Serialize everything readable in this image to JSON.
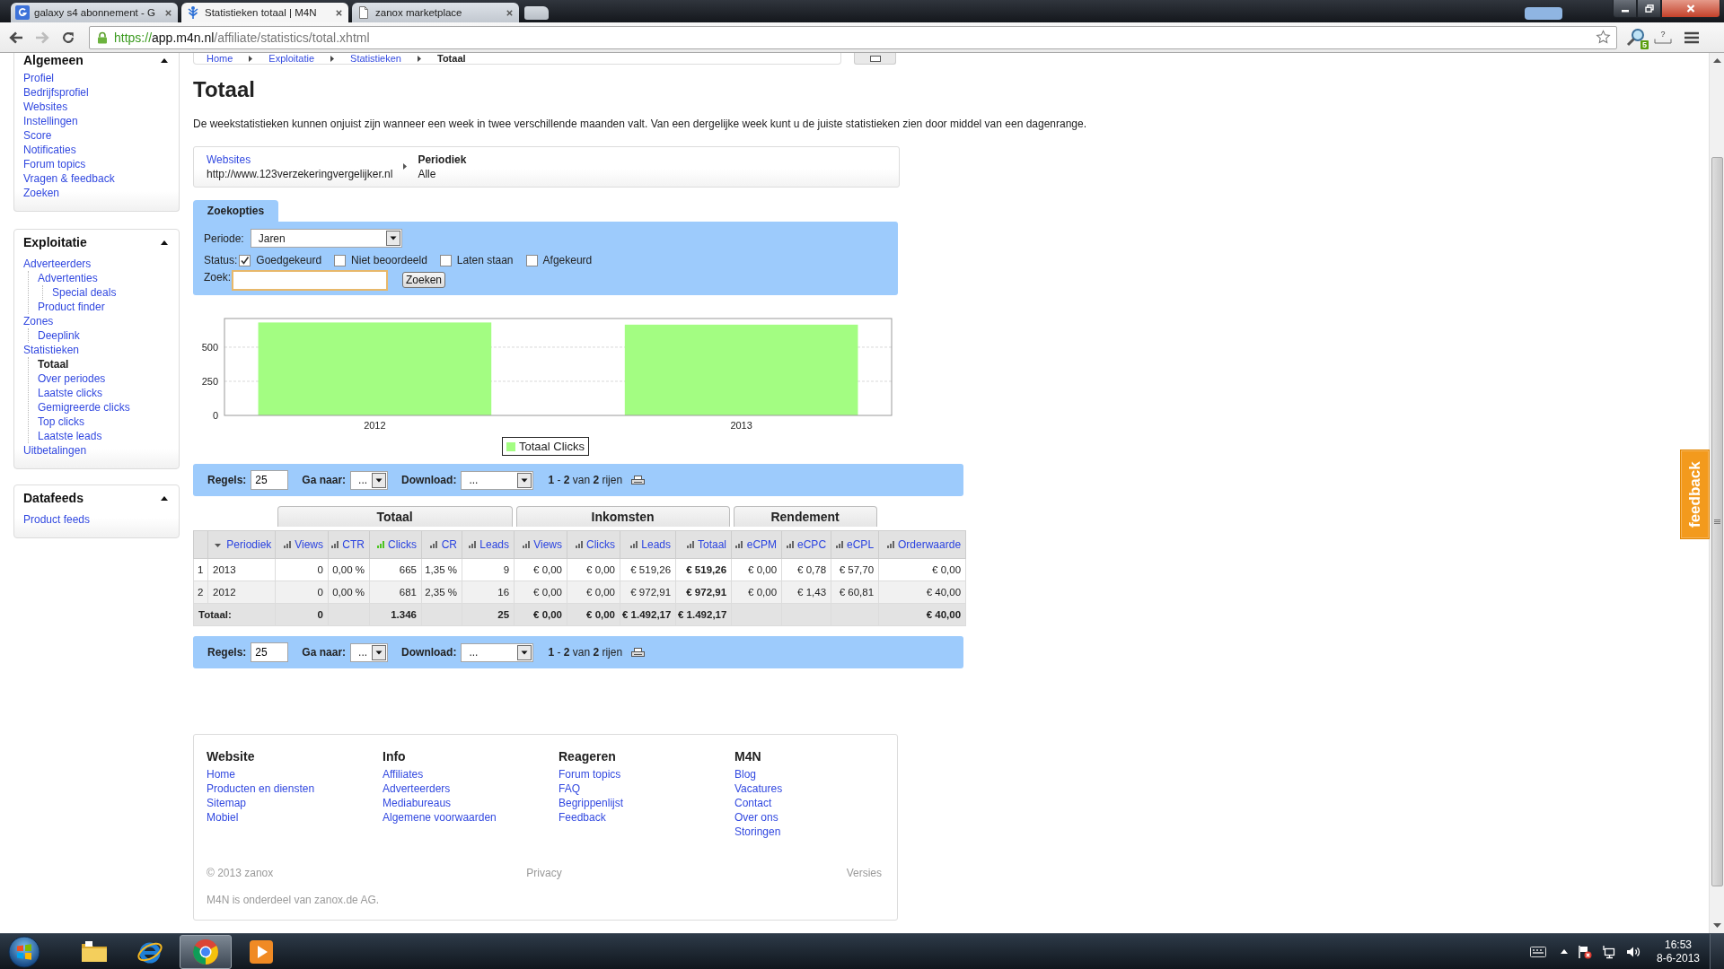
{
  "browser": {
    "tabs": [
      {
        "title": "galaxy s4 abonnement - G",
        "selected": false
      },
      {
        "title": "Statistieken totaal | M4N",
        "selected": true
      },
      {
        "title": "zanox marketplace",
        "selected": false
      }
    ],
    "back": {
      "disabled": false
    },
    "forward": {
      "disabled": true
    },
    "url": {
      "scheme": "https://",
      "host": "app.m4n.nl",
      "path": "/affiliate/statistics/total.xhtml"
    },
    "extension_badge": "5",
    "help_glyph": "?"
  },
  "breadcrumb": [
    {
      "label": "Home",
      "current": false
    },
    {
      "label": "Exploitatie",
      "current": false
    },
    {
      "label": "Statistieken",
      "current": false
    },
    {
      "label": "Totaal",
      "current": true
    }
  ],
  "sidebar": {
    "sections": [
      {
        "title": "Algemeen",
        "expanded": true,
        "items": [
          {
            "label": "Profiel",
            "selected": false
          },
          {
            "label": "Bedrijfsprofiel",
            "selected": false
          },
          {
            "label": "Websites",
            "selected": false
          },
          {
            "label": "Instellingen",
            "selected": false
          },
          {
            "label": "Score",
            "selected": false
          },
          {
            "label": "Notificaties",
            "selected": false
          },
          {
            "label": "Forum topics",
            "selected": false
          },
          {
            "label": "Vragen & feedback",
            "selected": false
          },
          {
            "label": "Zoeken",
            "selected": false
          }
        ]
      },
      {
        "title": "Exploitatie",
        "expanded": true,
        "items": [
          {
            "label": "Adverteerders",
            "selected": false,
            "children": [
              {
                "label": "Advertenties",
                "selected": false,
                "children": [
                  {
                    "label": "Special deals",
                    "selected": false
                  }
                ]
              },
              {
                "label": "Product finder",
                "selected": false
              }
            ]
          },
          {
            "label": "Zones",
            "selected": false,
            "children": [
              {
                "label": "Deeplink",
                "selected": false
              }
            ]
          },
          {
            "label": "Statistieken",
            "selected": false,
            "children": [
              {
                "label": "Totaal",
                "selected": true
              },
              {
                "label": "Over periodes",
                "selected": false
              },
              {
                "label": "Laatste clicks",
                "selected": false
              },
              {
                "label": "Gemigreerde clicks",
                "selected": false
              },
              {
                "label": "Top clicks",
                "selected": false
              },
              {
                "label": "Laatste leads",
                "selected": false
              }
            ]
          },
          {
            "label": "Uitbetalingen",
            "selected": false
          }
        ]
      },
      {
        "title": "Datafeeds",
        "expanded": true,
        "items": [
          {
            "label": "Product feeds",
            "selected": false
          }
        ]
      }
    ]
  },
  "page": {
    "title": "Totaal",
    "notice": "De weekstatistieken kunnen onjuist zijn wanneer een week in twee verschillende maanden valt. Van een dergelijke week kunt u de juiste statistieken zien door middel van een dagenrange."
  },
  "selection_steps": [
    {
      "label": "Websites",
      "value": "http://www.123verzekeringvergelijker.nl",
      "current": false
    },
    {
      "label": "Periodiek",
      "value": "Alle",
      "current": true
    }
  ],
  "search_options": {
    "tab": "Zoekopties",
    "period_label": "Periode:",
    "period_value": "Jaren",
    "status_label": "Status:",
    "statuses": [
      {
        "label": "Goedgekeurd",
        "checked": true
      },
      {
        "label": "Niet beoordeeld",
        "checked": false
      },
      {
        "label": "Laten staan",
        "checked": false
      },
      {
        "label": "Afgekeurd",
        "checked": false
      }
    ],
    "search_label": "Zoek:",
    "search_field": {
      "focused": true
    },
    "search_button": "Zoeken"
  },
  "chart": {
    "chart_data": {
      "type": "bar",
      "categories": [
        "2012",
        "2013"
      ],
      "series": [
        {
          "name": "Totaal Clicks",
          "color": "#a3fd82",
          "values": [
            681,
            665
          ]
        }
      ],
      "ylim": [
        0,
        710
      ],
      "yticks": [
        0,
        250,
        500
      ]
    }
  },
  "pager_top": {
    "rows_label": "Regels:",
    "rows_value": "25",
    "goto_label": "Ga naar:",
    "goto_value": "...",
    "download_label": "Download:",
    "download_value": "...",
    "summary": "**1** - **2** van **2** rijen"
  },
  "table": {
    "lead_column": {
      "label": "Periodiek",
      "sort_descending": true
    },
    "groups": [
      {
        "label": "Totaal",
        "columns": [
          {
            "label": "Views",
            "charted": false,
            "strong": false
          },
          {
            "label": "CTR",
            "charted": false,
            "strong": false
          },
          {
            "label": "Clicks",
            "charted": true,
            "strong": false
          },
          {
            "label": "CR",
            "charted": false,
            "strong": false
          },
          {
            "label": "Leads",
            "charted": false,
            "strong": false
          }
        ]
      },
      {
        "label": "Inkomsten",
        "columns": [
          {
            "label": "Views",
            "charted": false,
            "strong": false
          },
          {
            "label": "Clicks",
            "charted": false,
            "strong": false
          },
          {
            "label": "Leads",
            "charted": false,
            "strong": false
          },
          {
            "label": "Totaal",
            "charted": false,
            "strong": true
          }
        ]
      },
      {
        "label": "Rendement",
        "columns": [
          {
            "label": "eCPM",
            "charted": false,
            "strong": false
          },
          {
            "label": "eCPC",
            "charted": false,
            "strong": false
          },
          {
            "label": "eCPL",
            "charted": false,
            "strong": false
          }
        ]
      }
    ],
    "trailing_columns": [
      {
        "label": "Orderwaarde",
        "charted": false,
        "strong": false
      }
    ],
    "rows": [
      {
        "number": "1",
        "period": "2013",
        "cells": [
          "0",
          "0,00 %",
          "665",
          "1,35 %",
          "9",
          "€ 0,00",
          "€ 0,00",
          "€ 519,26",
          "€ 519,26",
          "€ 0,00",
          "€ 0,78",
          "€ 57,70",
          "€ 0,00"
        ]
      },
      {
        "number": "2",
        "period": "2012",
        "cells": [
          "0",
          "0,00 %",
          "681",
          "2,35 %",
          "16",
          "€ 0,00",
          "€ 0,00",
          "€ 972,91",
          "€ 972,91",
          "€ 0,00",
          "€ 1,43",
          "€ 60,81",
          "€ 40,00"
        ]
      }
    ],
    "total": {
      "label": "Totaal:",
      "cells": [
        "0",
        null,
        "1.346",
        null,
        "25",
        "€ 0,00",
        "€ 0,00",
        "€ 1.492,17",
        "€ 1.492,17",
        null,
        null,
        null,
        "€ 40,00"
      ]
    }
  },
  "pager_bottom": {
    "rows_label": "Regels:",
    "rows_value": "25",
    "goto_label": "Ga naar:",
    "goto_value": "...",
    "download_label": "Download:",
    "download_value": "...",
    "summary": "**1** - **2** van **2** rijen"
  },
  "footer": {
    "columns": [
      {
        "title": "Website",
        "links": [
          "Home",
          "Producten en diensten",
          "Sitemap",
          "Mobiel"
        ]
      },
      {
        "title": "Info",
        "links": [
          "Affiliates",
          "Adverteerders",
          "Mediabureaus",
          "Algemene voorwaarden"
        ]
      },
      {
        "title": "Reageren",
        "links": [
          "Forum topics",
          "FAQ",
          "Begrippenlijst",
          "Feedback"
        ]
      },
      {
        "title": "M4N",
        "links": [
          "Blog",
          "Vacatures",
          "Contact",
          "Over ons",
          "Storingen"
        ]
      }
    ],
    "copyright": "© 2013 zanox",
    "privacy": "Privacy",
    "versions": "Versies",
    "note": "M4N is onderdeel van zanox.de AG."
  },
  "feedback_tab": "feedback",
  "taskbar": {
    "apps": [
      {
        "active": false
      },
      {
        "active": false
      },
      {
        "active": true
      },
      {
        "active": false
      }
    ],
    "time": "16:53",
    "date": "8-6-2013"
  }
}
